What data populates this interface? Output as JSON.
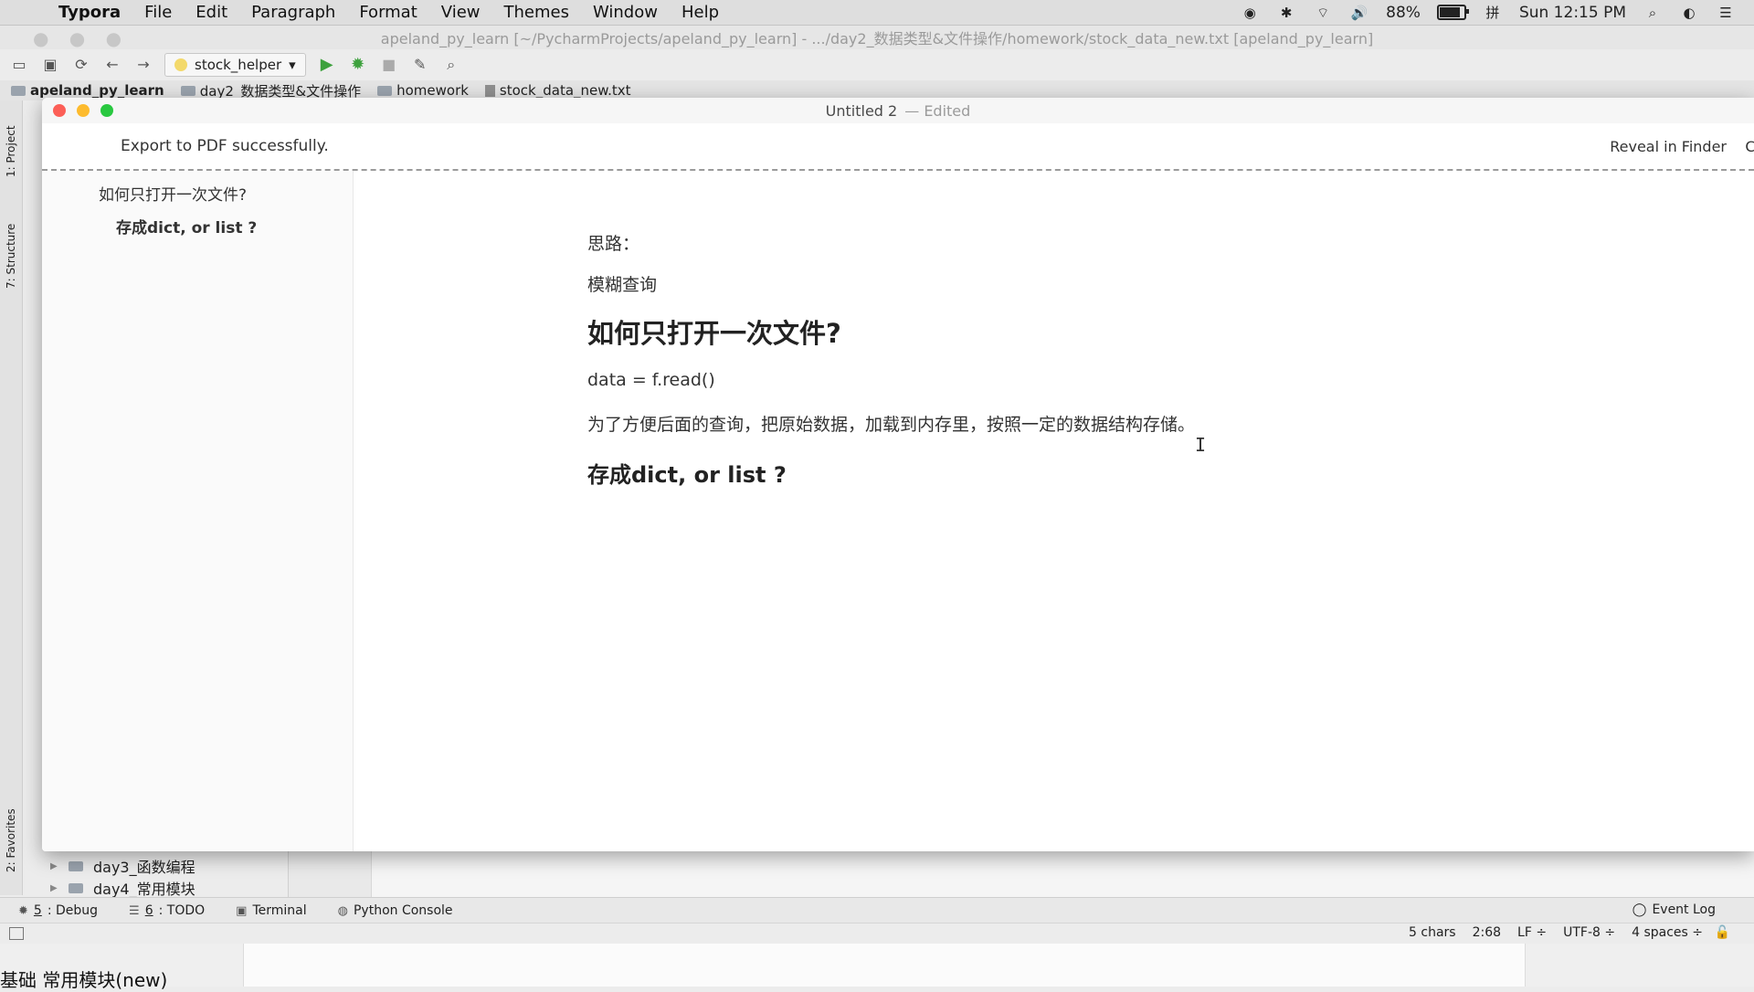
{
  "menubar": {
    "app": "Typora",
    "items": [
      "File",
      "Edit",
      "Paragraph",
      "Format",
      "View",
      "Themes",
      "Window",
      "Help"
    ],
    "battery": "88%",
    "clock": "Sun 12:15 PM"
  },
  "ide": {
    "window_title": "apeland_py_learn [~/PycharmProjects/apeland_py_learn] - .../day2_数据类型&文件操作/homework/stock_data_new.txt [apeland_py_learn]",
    "run_config": "stock_helper",
    "breadcrumbs": [
      "apeland_py_learn",
      "day2_数据类型&文件操作",
      "homework",
      "stock_data_new.txt"
    ],
    "vertical_tabs": [
      "1: Project",
      "7: Structure",
      "2: Favorites"
    ],
    "tree": [
      "day3_函数编程",
      "day4_常用模块"
    ],
    "toolwindows": [
      {
        "num": "5",
        "label": ": Debug"
      },
      {
        "num": "6",
        "label": ": TODO"
      },
      {
        "num": "",
        "label": "Terminal"
      },
      {
        "num": "",
        "label": "Python Console"
      }
    ],
    "event_log": "Event Log",
    "status": [
      "5 chars",
      "2:68",
      "LF ÷",
      "UTF-8 ÷",
      "4 spaces ÷"
    ],
    "bottom_caption": "基础 常用模块(new)"
  },
  "typora": {
    "title": "Untitled 2",
    "edited": "— Edited",
    "notice": "Export to PDF successfully.",
    "reveal": "Reveal in Finder",
    "clear": "Cl",
    "outline": [
      "如何只打开一次文件?",
      "存成dict, or list ?"
    ],
    "content": {
      "p1": "思路：",
      "p2": "模糊查询",
      "h1": "如何只打开一次文件?",
      "code_line": "data = f.read()",
      "p3": "为了方便后面的查询，把原始数据，加载到内存里，按照一定的数据结构存储。",
      "h2": "存成dict, or list ?"
    }
  }
}
